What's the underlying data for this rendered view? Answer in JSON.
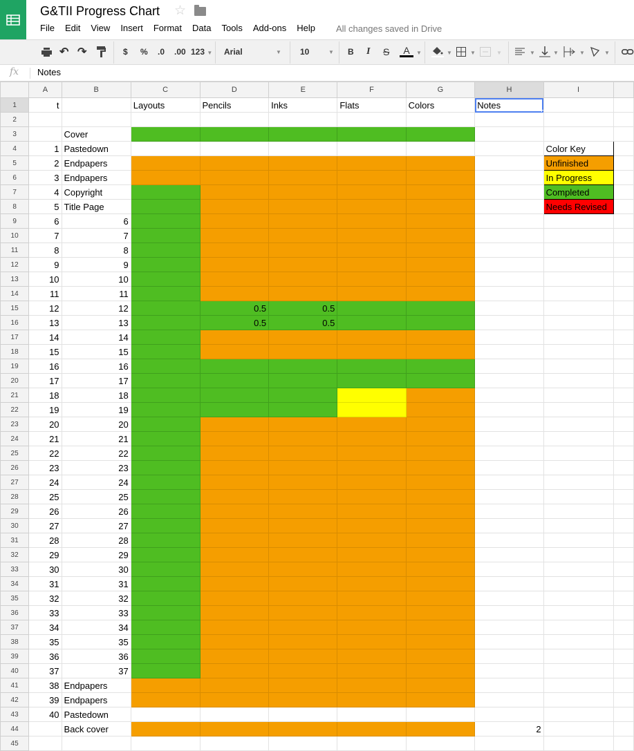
{
  "app": {
    "title": "G&TII Progress Chart",
    "menu": [
      "File",
      "Edit",
      "View",
      "Insert",
      "Format",
      "Data",
      "Tools",
      "Add-ons",
      "Help"
    ],
    "save_status": "All changes saved in Drive"
  },
  "toolbar": {
    "currency": "$",
    "percent": "%",
    "decrease_decimal": ".0",
    "increase_decimal": ".00",
    "more_formats": "123",
    "font": "Arial",
    "font_size": "10",
    "bold": "B",
    "italic": "I",
    "strikethrough": "S",
    "text_color": "A"
  },
  "formula_bar": {
    "fx": "fx",
    "value": "Notes"
  },
  "selected_cell": "H1",
  "colors": {
    "green": "#4fbd22",
    "orange": "#f59e00",
    "yellow": "#ffff00",
    "red": "#ff0000"
  },
  "columns": [
    "A",
    "B",
    "C",
    "D",
    "E",
    "F",
    "G",
    "H",
    "I"
  ],
  "rows": [
    {
      "n": "1",
      "a": "t",
      "b": "",
      "c": "Layouts",
      "d": "Pencils",
      "e": "Inks",
      "f": "Flats",
      "g": "Colors",
      "h": "Notes",
      "fill": [
        "w",
        "w",
        "w",
        "w",
        "w"
      ]
    },
    {
      "n": "2",
      "a": "",
      "b": "",
      "fill": [
        "w",
        "w",
        "w",
        "w",
        "w"
      ]
    },
    {
      "n": "3",
      "a": "",
      "b": "Cover",
      "fill": [
        "g",
        "g",
        "g",
        "g",
        "g"
      ]
    },
    {
      "n": "4",
      "a": "1",
      "b": "Pastedown",
      "fill": [
        "w",
        "w",
        "w",
        "w",
        "w"
      ],
      "i": "Color Key",
      "ifill": "w"
    },
    {
      "n": "5",
      "a": "2",
      "b": "Endpapers",
      "fill": [
        "o",
        "o",
        "o",
        "o",
        "o"
      ],
      "i": "Unfinished",
      "ifill": "o"
    },
    {
      "n": "6",
      "a": "3",
      "b": "Endpapers",
      "fill": [
        "o",
        "o",
        "o",
        "o",
        "o"
      ],
      "i": "In Progress",
      "ifill": "y"
    },
    {
      "n": "7",
      "a": "4",
      "b": "Copyright",
      "fill": [
        "g",
        "o",
        "o",
        "o",
        "o"
      ],
      "i": "Completed",
      "ifill": "g"
    },
    {
      "n": "8",
      "a": "5",
      "b": "Title Page",
      "fill": [
        "g",
        "o",
        "o",
        "o",
        "o"
      ],
      "i": "Needs Revised",
      "ifill": "r"
    },
    {
      "n": "9",
      "a": "6",
      "b": "6",
      "fill": [
        "g",
        "o",
        "o",
        "o",
        "o"
      ]
    },
    {
      "n": "10",
      "a": "7",
      "b": "7",
      "fill": [
        "g",
        "o",
        "o",
        "o",
        "o"
      ]
    },
    {
      "n": "11",
      "a": "8",
      "b": "8",
      "fill": [
        "g",
        "o",
        "o",
        "o",
        "o"
      ]
    },
    {
      "n": "12",
      "a": "9",
      "b": "9",
      "fill": [
        "g",
        "o",
        "o",
        "o",
        "o"
      ]
    },
    {
      "n": "13",
      "a": "10",
      "b": "10",
      "fill": [
        "g",
        "o",
        "o",
        "o",
        "o"
      ]
    },
    {
      "n": "14",
      "a": "11",
      "b": "11",
      "fill": [
        "g",
        "o",
        "o",
        "o",
        "o"
      ]
    },
    {
      "n": "15",
      "a": "12",
      "b": "12",
      "d": "0.5",
      "e": "0.5",
      "fill": [
        "g",
        "g",
        "g",
        "g",
        "g"
      ]
    },
    {
      "n": "16",
      "a": "13",
      "b": "13",
      "d": "0.5",
      "e": "0.5",
      "fill": [
        "g",
        "g",
        "g",
        "g",
        "g"
      ]
    },
    {
      "n": "17",
      "a": "14",
      "b": "14",
      "fill": [
        "g",
        "o",
        "o",
        "o",
        "o"
      ]
    },
    {
      "n": "18",
      "a": "15",
      "b": "15",
      "fill": [
        "g",
        "o",
        "o",
        "o",
        "o"
      ]
    },
    {
      "n": "19",
      "a": "16",
      "b": "16",
      "fill": [
        "g",
        "g",
        "g",
        "g",
        "g"
      ]
    },
    {
      "n": "20",
      "a": "17",
      "b": "17",
      "fill": [
        "g",
        "g",
        "g",
        "g",
        "g"
      ]
    },
    {
      "n": "21",
      "a": "18",
      "b": "18",
      "fill": [
        "g",
        "g",
        "g",
        "y",
        "o"
      ]
    },
    {
      "n": "22",
      "a": "19",
      "b": "19",
      "fill": [
        "g",
        "g",
        "g",
        "y",
        "o"
      ]
    },
    {
      "n": "23",
      "a": "20",
      "b": "20",
      "fill": [
        "g",
        "o",
        "o",
        "o",
        "o"
      ]
    },
    {
      "n": "24",
      "a": "21",
      "b": "21",
      "fill": [
        "g",
        "o",
        "o",
        "o",
        "o"
      ]
    },
    {
      "n": "25",
      "a": "22",
      "b": "22",
      "fill": [
        "g",
        "o",
        "o",
        "o",
        "o"
      ]
    },
    {
      "n": "26",
      "a": "23",
      "b": "23",
      "fill": [
        "g",
        "o",
        "o",
        "o",
        "o"
      ]
    },
    {
      "n": "27",
      "a": "24",
      "b": "24",
      "fill": [
        "g",
        "o",
        "o",
        "o",
        "o"
      ]
    },
    {
      "n": "28",
      "a": "25",
      "b": "25",
      "fill": [
        "g",
        "o",
        "o",
        "o",
        "o"
      ]
    },
    {
      "n": "29",
      "a": "26",
      "b": "26",
      "fill": [
        "g",
        "o",
        "o",
        "o",
        "o"
      ]
    },
    {
      "n": "30",
      "a": "27",
      "b": "27",
      "fill": [
        "g",
        "o",
        "o",
        "o",
        "o"
      ]
    },
    {
      "n": "31",
      "a": "28",
      "b": "28",
      "fill": [
        "g",
        "o",
        "o",
        "o",
        "o"
      ]
    },
    {
      "n": "32",
      "a": "29",
      "b": "29",
      "fill": [
        "g",
        "o",
        "o",
        "o",
        "o"
      ]
    },
    {
      "n": "33",
      "a": "30",
      "b": "30",
      "fill": [
        "g",
        "o",
        "o",
        "o",
        "o"
      ]
    },
    {
      "n": "34",
      "a": "31",
      "b": "31",
      "fill": [
        "g",
        "o",
        "o",
        "o",
        "o"
      ]
    },
    {
      "n": "35",
      "a": "32",
      "b": "32",
      "fill": [
        "g",
        "o",
        "o",
        "o",
        "o"
      ]
    },
    {
      "n": "36",
      "a": "33",
      "b": "33",
      "fill": [
        "g",
        "o",
        "o",
        "o",
        "o"
      ]
    },
    {
      "n": "37",
      "a": "34",
      "b": "34",
      "fill": [
        "g",
        "o",
        "o",
        "o",
        "o"
      ]
    },
    {
      "n": "38",
      "a": "35",
      "b": "35",
      "fill": [
        "g",
        "o",
        "o",
        "o",
        "o"
      ]
    },
    {
      "n": "39",
      "a": "36",
      "b": "36",
      "fill": [
        "g",
        "o",
        "o",
        "o",
        "o"
      ]
    },
    {
      "n": "40",
      "a": "37",
      "b": "37",
      "fill": [
        "g",
        "o",
        "o",
        "o",
        "o"
      ]
    },
    {
      "n": "41",
      "a": "38",
      "b": "Endpapers",
      "fill": [
        "o",
        "o",
        "o",
        "o",
        "o"
      ]
    },
    {
      "n": "42",
      "a": "39",
      "b": "Endpapers",
      "fill": [
        "o",
        "o",
        "o",
        "o",
        "o"
      ]
    },
    {
      "n": "43",
      "a": "40",
      "b": "Pastedown",
      "fill": [
        "w",
        "w",
        "w",
        "w",
        "w"
      ]
    },
    {
      "n": "44",
      "a": "",
      "b": "Back cover",
      "h": "2",
      "fill": [
        "o",
        "o",
        "o",
        "o",
        "o"
      ]
    },
    {
      "n": "45",
      "a": "",
      "b": "",
      "fill": [
        "w",
        "w",
        "w",
        "w",
        "w"
      ]
    }
  ]
}
